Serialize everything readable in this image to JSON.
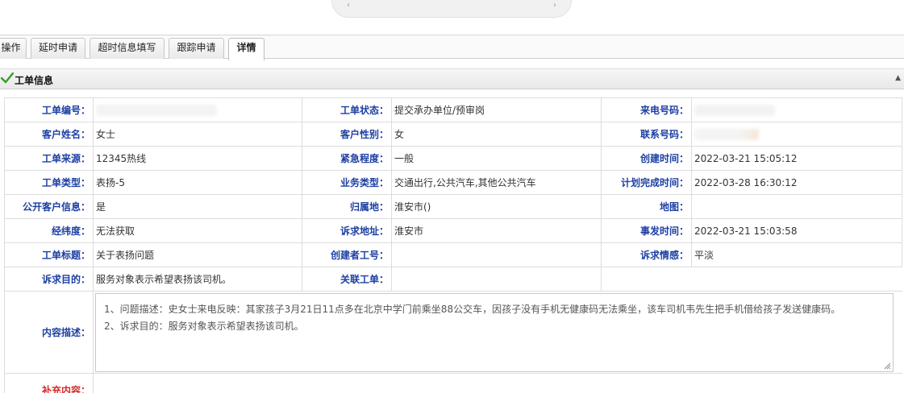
{
  "tabs": [
    {
      "label": "操作",
      "active": false
    },
    {
      "label": "延时申请",
      "active": false
    },
    {
      "label": "超时信息填写",
      "active": false
    },
    {
      "label": "跟踪申请",
      "active": false
    },
    {
      "label": "详情",
      "active": true
    }
  ],
  "section": {
    "title": "工单信息",
    "check_icon": "check-icon",
    "collapse_icon": "collapse-up-icon"
  },
  "fields": {
    "order_no": {
      "label": "工单编号：",
      "value": ""
    },
    "order_status": {
      "label": "工单状态：",
      "value": "提交承办单位/预审岗"
    },
    "caller_no": {
      "label": "来电号码：",
      "value": ""
    },
    "customer_name": {
      "label": "客户姓名：",
      "value": "女士"
    },
    "customer_gender": {
      "label": "客户性别：",
      "value": "女"
    },
    "contact_no": {
      "label": "联系号码：",
      "value": ""
    },
    "source": {
      "label": "工单来源：",
      "value": "12345热线"
    },
    "urgency": {
      "label": "紧急程度：",
      "value": "一般"
    },
    "created_at": {
      "label": "创建时间：",
      "value": "2022-03-21 15:05:12"
    },
    "order_type": {
      "label": "工单类型：",
      "value": "表扬-5"
    },
    "business_type": {
      "label": "业务类型：",
      "value": "交通出行,公共汽车,其他公共汽车"
    },
    "planned_done": {
      "label": "计划完成时间：",
      "value": "2022-03-28 16:30:12"
    },
    "public_info": {
      "label": "公开客户信息：",
      "value": "是"
    },
    "locality": {
      "label": "归属地：",
      "value": "淮安市()"
    },
    "map": {
      "label": "地图：",
      "value": ""
    },
    "coords": {
      "label": "经纬度：",
      "value": "无法获取"
    },
    "appeal_address": {
      "label": "诉求地址：",
      "value": "淮安市"
    },
    "incident_time": {
      "label": "事发时间：",
      "value": "2022-03-21 15:03:58"
    },
    "order_title": {
      "label": "工单标题：",
      "value": "关于表扬问题"
    },
    "creator_id": {
      "label": "创建者工号：",
      "value": ""
    },
    "appeal_mood": {
      "label": "诉求情感：",
      "value": "平淡"
    },
    "appeal_purpose": {
      "label": "诉求目的：",
      "value": "服务对象表示希望表扬该司机。"
    },
    "linked_order": {
      "label": "关联工单：",
      "value": ""
    }
  },
  "content": {
    "label": "内容描述：",
    "line1": "1、问题描述：史女士来电反映：其家孩子3月21日11点多在北京中学门前乘坐88公交车，因孩子没有手机无健康码无法乘坐，该车司机韦先生把手机借给孩子发送健康码。",
    "line2": "2、诉求目的：服务对象表示希望表扬该司机。"
  },
  "supplement": {
    "label": "补充内容："
  },
  "colors": {
    "label_blue": "#1d3fa3",
    "check_green": "#3a9a2c",
    "supplement_red": "#d62b2b"
  }
}
